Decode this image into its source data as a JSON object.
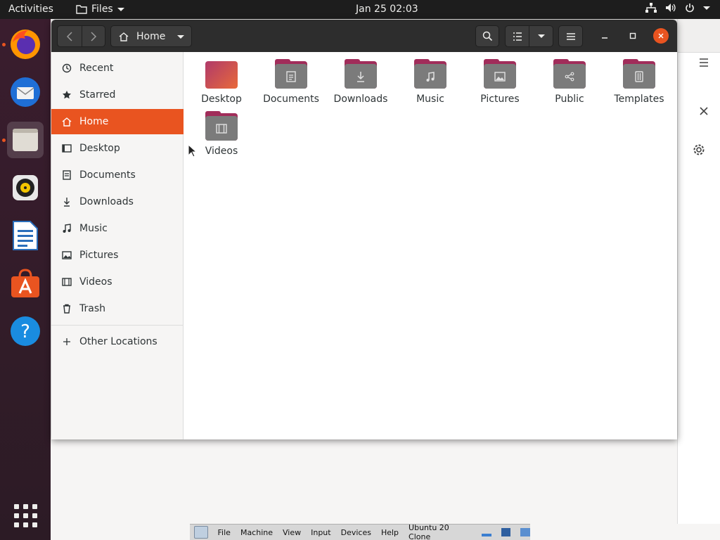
{
  "topbar": {
    "activities": "Activities",
    "app_menu": "Files",
    "clock": "Jan 25  02:03"
  },
  "dock": {
    "apps": [
      "firefox-icon",
      "thunderbird-icon",
      "files-icon",
      "rhythmbox-icon",
      "libreoffice-writer-icon",
      "ubuntu-software-icon",
      "help-icon"
    ],
    "active": "files-icon"
  },
  "window": {
    "location": "Home"
  },
  "sidebar": {
    "items": [
      {
        "label": "Recent",
        "icon": "clock-icon"
      },
      {
        "label": "Starred",
        "icon": "star-icon"
      },
      {
        "label": "Home",
        "icon": "home-icon",
        "selected": true
      },
      {
        "label": "Desktop",
        "icon": "desktop-icon"
      },
      {
        "label": "Documents",
        "icon": "documents-icon"
      },
      {
        "label": "Downloads",
        "icon": "downloads-icon"
      },
      {
        "label": "Music",
        "icon": "music-icon"
      },
      {
        "label": "Pictures",
        "icon": "pictures-icon"
      },
      {
        "label": "Videos",
        "icon": "videos-icon"
      },
      {
        "label": "Trash",
        "icon": "trash-icon"
      }
    ],
    "other_locations": "Other Locations"
  },
  "folders": [
    {
      "label": "Desktop",
      "icon": "desktop-folder-icon"
    },
    {
      "label": "Documents",
      "icon": "documents-folder-icon"
    },
    {
      "label": "Downloads",
      "icon": "downloads-folder-icon"
    },
    {
      "label": "Music",
      "icon": "music-folder-icon"
    },
    {
      "label": "Pictures",
      "icon": "pictures-folder-icon"
    },
    {
      "label": "Public",
      "icon": "public-folder-icon"
    },
    {
      "label": "Templates",
      "icon": "templates-folder-icon"
    },
    {
      "label": "Videos",
      "icon": "videos-folder-icon"
    }
  ],
  "vbox": {
    "menu": [
      "File",
      "Machine",
      "View",
      "Input",
      "Devices",
      "Help"
    ],
    "vm_name": "Ubuntu 20 Clone"
  },
  "colors": {
    "accent": "#e95420",
    "folder_tab": "#a12d5a",
    "folder_body": "#7b7b7b"
  }
}
